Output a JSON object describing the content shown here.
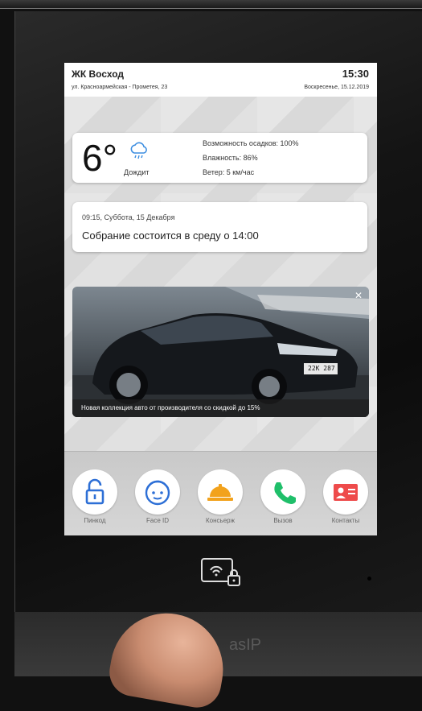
{
  "header": {
    "complex_name": "ЖК Восход",
    "address": "ул. Красноармейская - Прометея, 23",
    "time": "15:30",
    "date": "Воскресенье, 15.12.2019"
  },
  "weather": {
    "temperature": "6°",
    "condition": "Дождит",
    "icon": "rain-cloud-icon",
    "precipitation": "Возможность осадков: 100%",
    "humidity": "Влажность: 86%",
    "wind": "Ветер: 5 км/час"
  },
  "notice": {
    "timestamp": "09:15, Суббота, 15 Декабря",
    "text": "Собрание состоится в среду о 14:00"
  },
  "ad": {
    "caption": "Новая коллекция авто от производителя со скидкой до 15%",
    "close_icon": "close-icon",
    "plate": "22К 287"
  },
  "dock": {
    "items": [
      {
        "label": "Пинкод",
        "icon": "lock-icon",
        "color": "#2d6fd6"
      },
      {
        "label": "Face ID",
        "icon": "face-icon",
        "color": "#2d6fd6"
      },
      {
        "label": "Консьерж",
        "icon": "concierge-bell-icon",
        "color": "#f2a21c"
      },
      {
        "label": "Вызов",
        "icon": "phone-icon",
        "color": "#1fbf6a"
      },
      {
        "label": "Контакты",
        "icon": "contact-card-icon",
        "color": "#ee4b4b"
      }
    ]
  },
  "device": {
    "brand": "asIP",
    "nfc_icon": "nfc-reader-icon"
  }
}
